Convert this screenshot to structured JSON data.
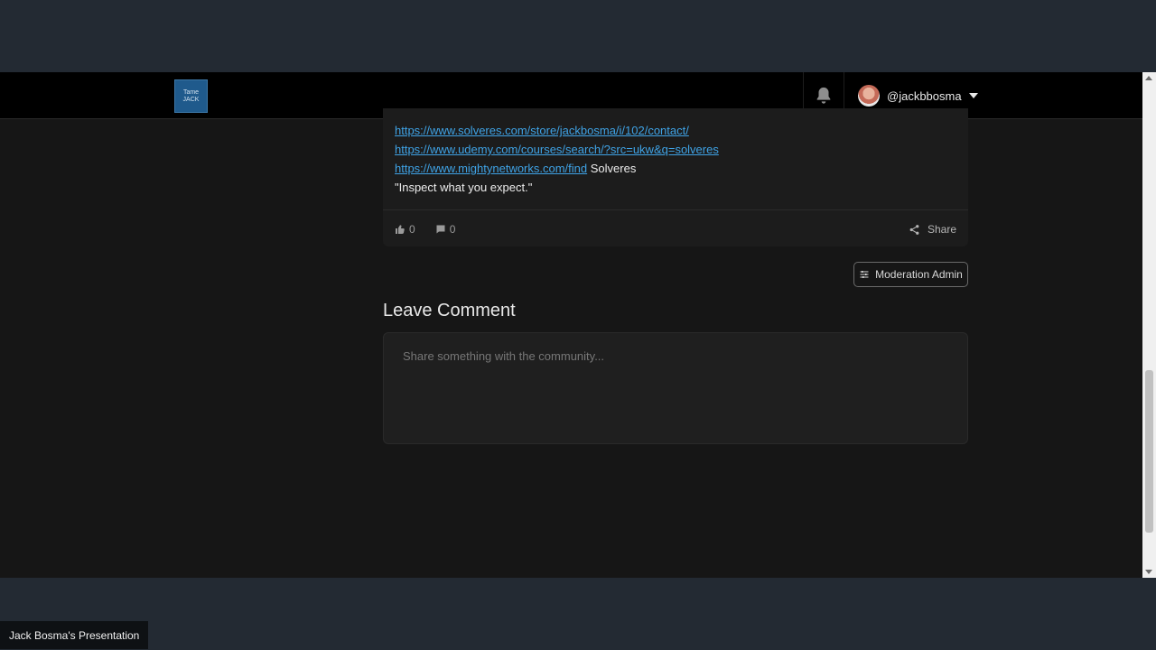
{
  "header": {
    "logo_text": "Tame JACK",
    "username": "@jackbbosma"
  },
  "post": {
    "links": [
      "https://www.solveres.com/store/jackbosma/i/102/contact/",
      "https://www.udemy.com/courses/search/?src=ukw&q=solveres",
      "https://www.mightynetworks.com/find"
    ],
    "link3_suffix": "Solveres",
    "quote": "\"Inspect what you expect.\"",
    "likes": "0",
    "comments": "0",
    "share_label": "Share"
  },
  "moderation": {
    "button_label": "Moderation Admin"
  },
  "comment": {
    "title": "Leave Comment",
    "placeholder": "Share something with the community..."
  },
  "presentation": {
    "label": "Jack Bosma's Presentation"
  }
}
